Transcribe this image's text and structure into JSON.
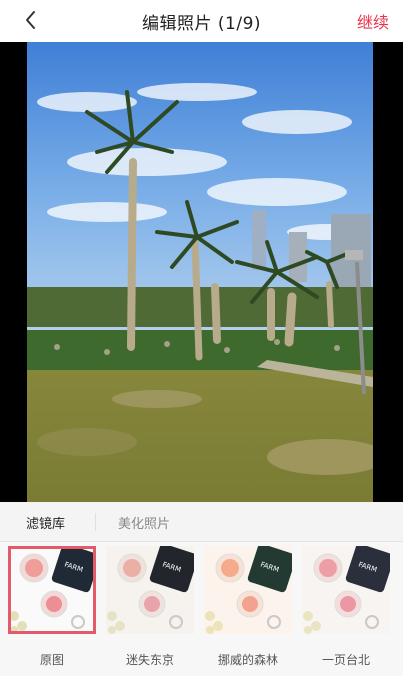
{
  "header": {
    "title": "编辑照片 (1/9)",
    "continue_label": "继续",
    "back_icon": "chevron-left-icon"
  },
  "tabs": [
    {
      "label": "滤镜库",
      "active": true
    },
    {
      "label": "美化照片",
      "active": false
    }
  ],
  "filters": [
    {
      "label": "原图",
      "selected": true
    },
    {
      "label": "迷失东京",
      "selected": false
    },
    {
      "label": "挪威的森林",
      "selected": false
    },
    {
      "label": "一页台北",
      "selected": false
    }
  ],
  "thumb_card_text": "FARM\nMARK",
  "colors": {
    "accent": "#e8334a",
    "selected_border": "#e35a6b"
  }
}
